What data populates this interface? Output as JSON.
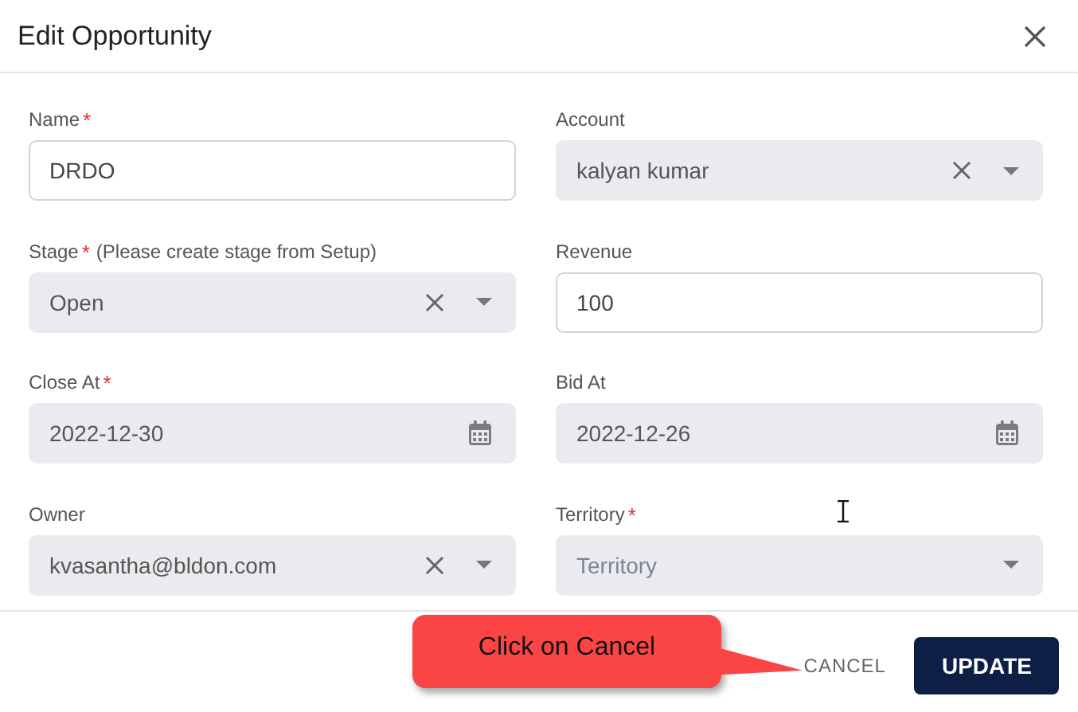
{
  "dialog": {
    "title": "Edit Opportunity"
  },
  "fields": [
    {
      "label": "Name",
      "required_mark": "*",
      "kind": "text",
      "value": "DRDO",
      "disabled": false
    },
    {
      "label": "Account",
      "kind": "select",
      "value": "kalyan kumar",
      "disabled": true,
      "clearable": true
    },
    {
      "label": "Stage",
      "required_mark": "*",
      "note": "(Please create stage from Setup)",
      "kind": "select",
      "value": "Open",
      "disabled": true,
      "clearable": true
    },
    {
      "label": "Revenue",
      "kind": "text",
      "value": "100",
      "disabled": false
    },
    {
      "label": "Close At",
      "required_mark": "*",
      "kind": "date",
      "value": "2022-12-30",
      "disabled": true
    },
    {
      "label": "Bid At",
      "kind": "date",
      "value": "2022-12-26",
      "disabled": true
    },
    {
      "label": "Owner",
      "kind": "select",
      "value": "kvasantha@bldon.com",
      "disabled": true,
      "clearable": true
    },
    {
      "label": "Territory",
      "required_mark": "*",
      "kind": "select",
      "placeholder": "Territory",
      "disabled": true,
      "clearable": false
    }
  ],
  "footer": {
    "cancel": "CANCEL",
    "update": "UPDATE"
  },
  "callout": {
    "text": "Click on Cancel"
  }
}
